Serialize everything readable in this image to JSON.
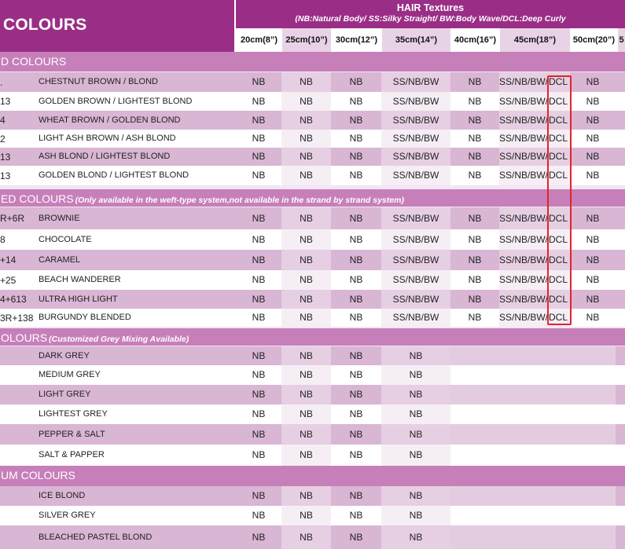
{
  "header": {
    "title": "COLOURS",
    "hair_textures": "HAIR Textures",
    "legend": "(NB:Natural Body/ SS:Silky Straight/ BW:Body Wave/DCL:Deep Curly",
    "lengths": [
      "20cm(8”)",
      "25cm(10”)",
      "30cm(12”)",
      "35cm(14”)",
      "40cm(16”)",
      "45cm(18”)",
      "50cm(20”)",
      "5"
    ]
  },
  "sections": [
    {
      "title": "D COLOURS",
      "note": "",
      "rows": [
        {
          "code": ".",
          "name": "CHESTNUT BROWN / BLOND",
          "values": [
            "NB",
            "NB",
            "NB",
            "SS/NB/BW",
            "NB",
            "SS/NB/BW/",
            "DCL",
            "NB"
          ]
        },
        {
          "code": "13",
          "name": "GOLDEN BROWN / LIGHTEST BLOND",
          "values": [
            "NB",
            "NB",
            "NB",
            "SS/NB/BW",
            "NB",
            "SS/NB/BW/",
            "DCL",
            "NB"
          ]
        },
        {
          "code": "4",
          "name": "WHEAT BROWN / GOLDEN BLOND",
          "values": [
            "NB",
            "NB",
            "NB",
            "SS/NB/BW",
            "NB",
            "SS/NB/BW/",
            "DCL",
            "NB"
          ]
        },
        {
          "code": "2",
          "name": "LIGHT ASH BROWN / ASH BLOND",
          "values": [
            "NB",
            "NB",
            "NB",
            "SS/NB/BW",
            "NB",
            "SS/NB/BW/",
            "DCL",
            "NB"
          ]
        },
        {
          "code": "13",
          "name": "ASH BLOND / LIGHTEST BLOND",
          "values": [
            "NB",
            "NB",
            "NB",
            "SS/NB/BW",
            "NB",
            "SS/NB/BW/",
            "DCL",
            "NB"
          ]
        },
        {
          "code": "13",
          "name": "GOLDEN BLOND / LIGHTEST BLOND",
          "values": [
            "NB",
            "NB",
            "NB",
            "SS/NB/BW",
            "NB",
            "SS/NB/BW/",
            "DCL",
            "NB"
          ]
        }
      ]
    },
    {
      "title": "ED COLOURS",
      "note": "(Only available in the weft-type system,not available in the strand by strand system)",
      "rows": [
        {
          "code": "R+6R",
          "name": "BROWNIE",
          "values": [
            "NB",
            "NB",
            "NB",
            "SS/NB/BW",
            "NB",
            "SS/NB/BW/",
            "DCL",
            "NB"
          ]
        },
        {
          "code": "8",
          "name": "CHOCOLATE",
          "values": [
            "NB",
            "NB",
            "NB",
            "SS/NB/BW",
            "NB",
            "SS/NB/BW/",
            "DCL",
            "NB"
          ]
        },
        {
          "code": "+14",
          "name": "CARAMEL",
          "values": [
            "NB",
            "NB",
            "NB",
            "SS/NB/BW",
            "NB",
            "SS/NB/BW/",
            "DCL",
            "NB"
          ]
        },
        {
          "code": "+25",
          "name": "BEACH WANDERER",
          "values": [
            "NB",
            "NB",
            "NB",
            "SS/NB/BW",
            "NB",
            "SS/NB/BW/",
            "DCL",
            "NB"
          ]
        },
        {
          "code": "4+613",
          "name": "ULTRA HIGH LIGHT",
          "values": [
            "NB",
            "NB",
            "NB",
            "SS/NB/BW",
            "NB",
            "SS/NB/BW/",
            "DCL",
            "NB"
          ]
        },
        {
          "code": "3R+138",
          "name": "BURGUNDY BLENDED",
          "values": [
            "NB",
            "NB",
            "NB",
            "SS/NB/BW",
            "NB",
            "SS/NB/BW/",
            "DCL",
            "NB"
          ]
        }
      ]
    },
    {
      "title": "OLOURS",
      "note": "(Customized Grey Mixing Available)",
      "rows": [
        {
          "code": "",
          "name": "DARK GREY",
          "values": [
            "NB",
            "NB",
            "NB",
            "NB",
            "",
            "",
            "",
            ""
          ]
        },
        {
          "code": "",
          "name": "MEDIUM GREY",
          "values": [
            "NB",
            "NB",
            "NB",
            "NB",
            "",
            "",
            "",
            ""
          ]
        },
        {
          "code": "",
          "name": "LIGHT GREY",
          "values": [
            "NB",
            "NB",
            "NB",
            "NB",
            "",
            "",
            "",
            ""
          ]
        },
        {
          "code": "",
          "name": "LIGHTEST GREY",
          "values": [
            "NB",
            "NB",
            "NB",
            "NB",
            "",
            "",
            "",
            ""
          ]
        },
        {
          "code": "",
          "name": "PEPPER & SALT",
          "values": [
            "NB",
            "NB",
            "NB",
            "NB",
            "",
            "",
            "",
            ""
          ]
        },
        {
          "code": "",
          "name": "SALT & PAPPER",
          "values": [
            "NB",
            "NB",
            "NB",
            "NB",
            "",
            "",
            "",
            ""
          ]
        }
      ]
    },
    {
      "title": "UM COLOURS",
      "note": "",
      "rows": [
        {
          "code": "",
          "name": "ICE BLOND",
          "values": [
            "NB",
            "NB",
            "NB",
            "NB",
            "",
            "",
            "",
            ""
          ]
        },
        {
          "code": "",
          "name": "SILVER GREY",
          "values": [
            "NB",
            "NB",
            "NB",
            "NB",
            "",
            "",
            "",
            ""
          ]
        },
        {
          "code": "",
          "name": "BLEACHED PASTEL BLOND",
          "values": [
            "NB",
            "NB",
            "NB",
            "NB",
            "",
            "",
            "",
            ""
          ]
        }
      ]
    }
  ]
}
